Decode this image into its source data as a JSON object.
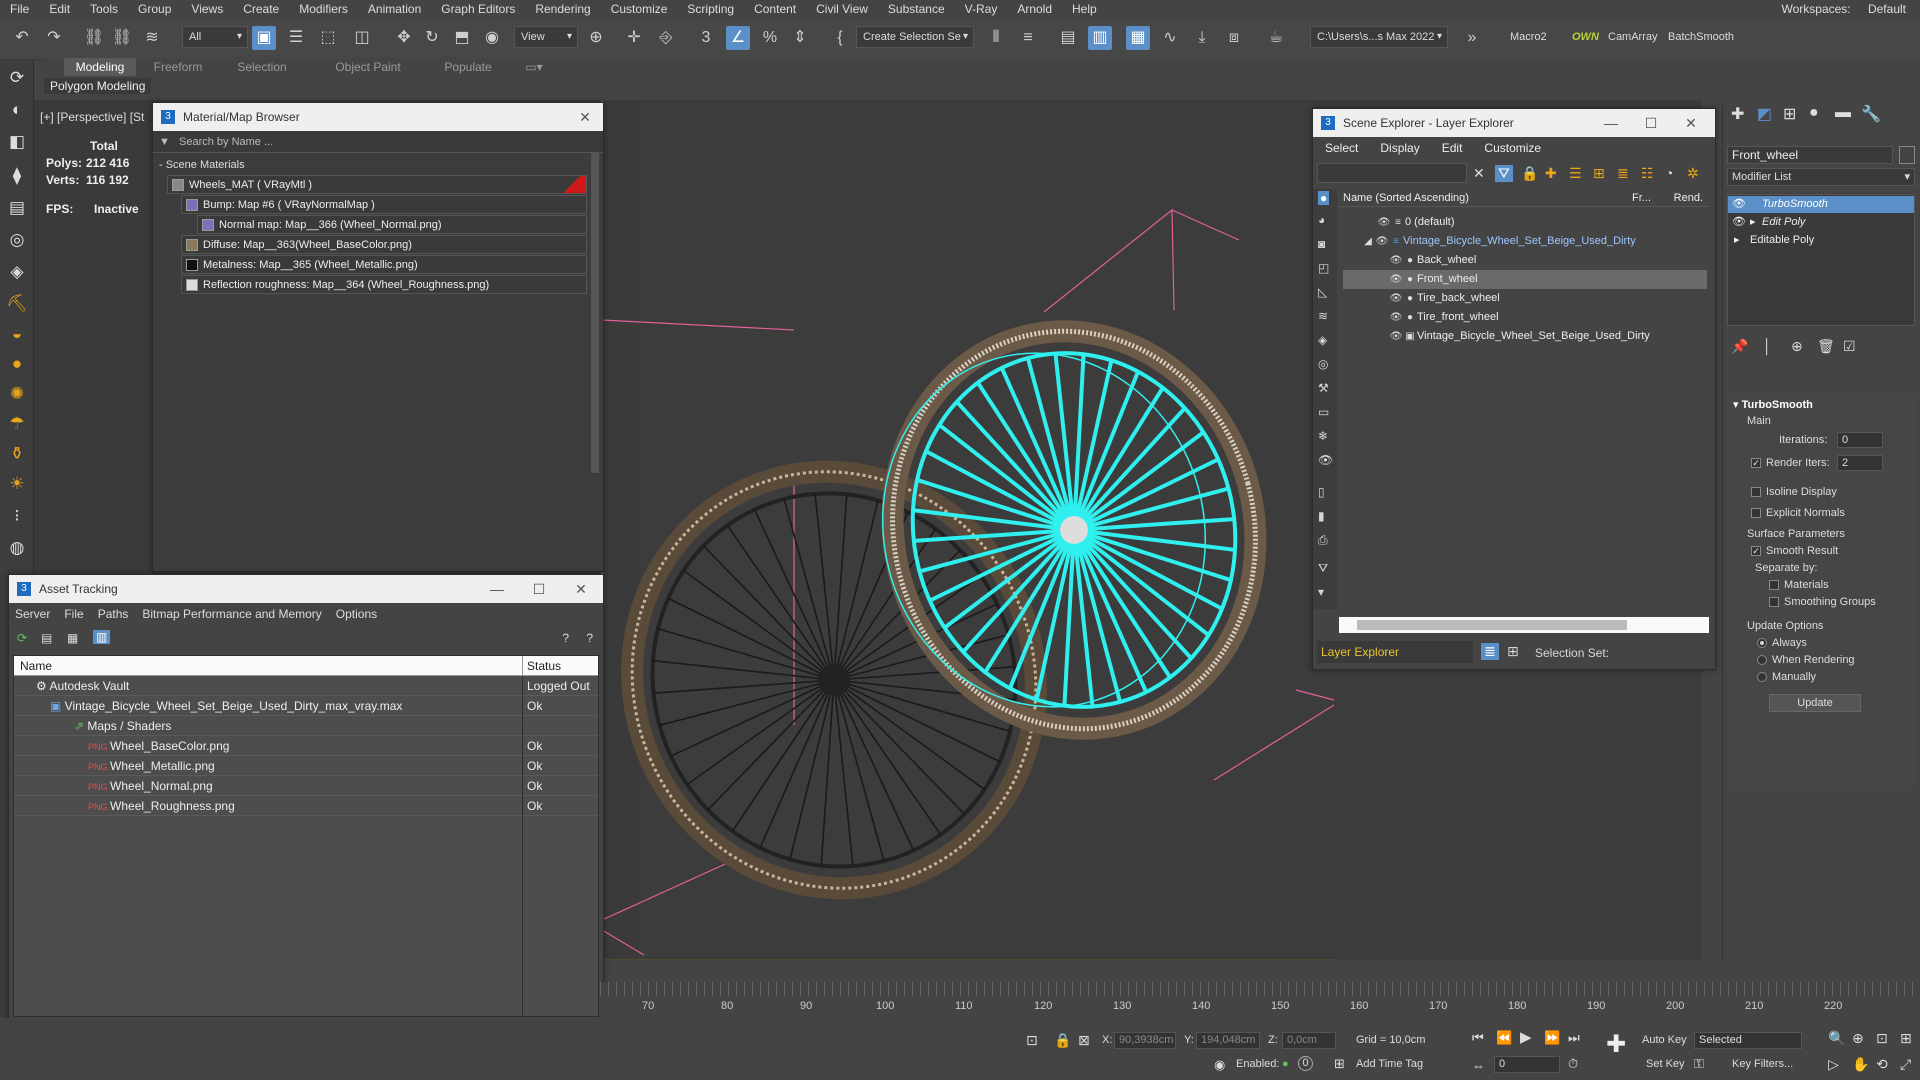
{
  "menu": {
    "items": [
      "File",
      "Edit",
      "Tools",
      "Group",
      "Views",
      "Create",
      "Modifiers",
      "Animation",
      "Graph Editors",
      "Rendering",
      "Customize",
      "Scripting",
      "Content",
      "Civil View",
      "Substance",
      "V-Ray",
      "Arnold",
      "Help"
    ],
    "workspaces_label": "Workspaces:",
    "workspace_value": "Default"
  },
  "toolbar": {
    "selection_filter": "All",
    "view_dropdown": "View",
    "create_selection_set": "Create Selection Se",
    "project_path": "C:\\Users\\s...s Max 2022",
    "macro": "Macro2",
    "own": "OWN",
    "camarray": "CamArray",
    "batchsmooth": "BatchSmooth"
  },
  "ribbon": {
    "tabs": [
      "Modeling",
      "Freeform",
      "Selection",
      "Object Paint",
      "Populate"
    ],
    "sub": "Polygon Modeling"
  },
  "viewport": {
    "label": "[+] [Perspective] [St",
    "stats": {
      "total": "Total",
      "polys_label": "Polys:",
      "polys": "212 416",
      "verts_label": "Verts:",
      "verts": "116 192",
      "fps_label": "FPS:",
      "fps": "Inactive"
    }
  },
  "material_browser": {
    "title": "Material/Map Browser",
    "search_placeholder": "Search by Name ...",
    "section": "- Scene Materials",
    "items": [
      "Wheels_MAT  ( VRayMtl )",
      "Bump: Map #6  ( VRayNormalMap )",
      "Normal map: Map__366 (Wheel_Normal.png)",
      "Diffuse: Map__363(Wheel_BaseColor.png)",
      "Metalness: Map__365 (Wheel_Metallic.png)",
      "Reflection roughness: Map__364 (Wheel_Roughness.png)"
    ]
  },
  "asset_tracking": {
    "title": "Asset Tracking",
    "menu": [
      "Server",
      "File",
      "Paths",
      "Bitmap Performance and Memory",
      "Options"
    ],
    "col_name": "Name",
    "col_status": "Status",
    "rows": [
      {
        "name": "Autodesk Vault",
        "status": "Logged Out"
      },
      {
        "name": "Vintage_Bicycle_Wheel_Set_Beige_Used_Dirty_max_vray.max",
        "status": "Ok"
      },
      {
        "name": "Maps / Shaders",
        "status": ""
      },
      {
        "name": "Wheel_BaseColor.png",
        "status": "Ok"
      },
      {
        "name": "Wheel_Metallic.png",
        "status": "Ok"
      },
      {
        "name": "Wheel_Normal.png",
        "status": "Ok"
      },
      {
        "name": "Wheel_Roughness.png",
        "status": "Ok"
      }
    ]
  },
  "scene_explorer": {
    "title": "Scene Explorer - Layer Explorer",
    "menu": [
      "Select",
      "Display",
      "Edit",
      "Customize"
    ],
    "col_name": "Name (Sorted Ascending)",
    "col_fr": "Fr...",
    "col_rend": "Rend.",
    "rows": [
      "0 (default)",
      "Vintage_Bicycle_Wheel_Set_Beige_Used_Dirty",
      "Back_wheel",
      "Front_wheel",
      "Tire_back_wheel",
      "Tire_front_wheel",
      "Vintage_Bicycle_Wheel_Set_Beige_Used_Dirty"
    ],
    "footer_dropdown": "Layer Explorer",
    "selection_set_label": "Selection Set:"
  },
  "command_panel": {
    "object_name": "Front_wheel",
    "modifier_list": "Modifier List",
    "stack": [
      "TurboSmooth",
      "Edit Poly",
      "Editable Poly"
    ],
    "rollout_title": "TurboSmooth",
    "main": "Main",
    "iterations_label": "Iterations:",
    "iterations": "0",
    "render_iters_label": "Render Iters:",
    "render_iters": "2",
    "isoline": "Isoline Display",
    "explicit_normals": "Explicit Normals",
    "surface_params": "Surface Parameters",
    "smooth_result": "Smooth Result",
    "separate_by": "Separate by:",
    "materials": "Materials",
    "smoothing_groups": "Smoothing Groups",
    "update_options": "Update Options",
    "always": "Always",
    "when_rendering": "When Rendering",
    "manually": "Manually",
    "update": "Update"
  },
  "timeline": {
    "ticks": [
      "70",
      "80",
      "90",
      "100",
      "110",
      "120",
      "130",
      "140",
      "150",
      "160",
      "170",
      "180",
      "190",
      "200",
      "210",
      "220"
    ]
  },
  "status": {
    "x_label": "X:",
    "x": "90,3938cm",
    "y_label": "Y:",
    "y": "194,048cm",
    "z_label": "Z:",
    "z": "0,0cm",
    "grid": "Grid = 10,0cm",
    "enabled": "Enabled:",
    "add_time_tag": "Add Time Tag",
    "auto_key": "Auto Key",
    "selected": "Selected",
    "set_key": "Set Key",
    "key_filters": "Key Filters...",
    "frame": "0"
  },
  "colors": {
    "accent": "#5b8fc7",
    "selection_cyan": "#2ff0ee",
    "helper_pink": "#e0609a",
    "viewport_bg": "#3a3a3a"
  }
}
